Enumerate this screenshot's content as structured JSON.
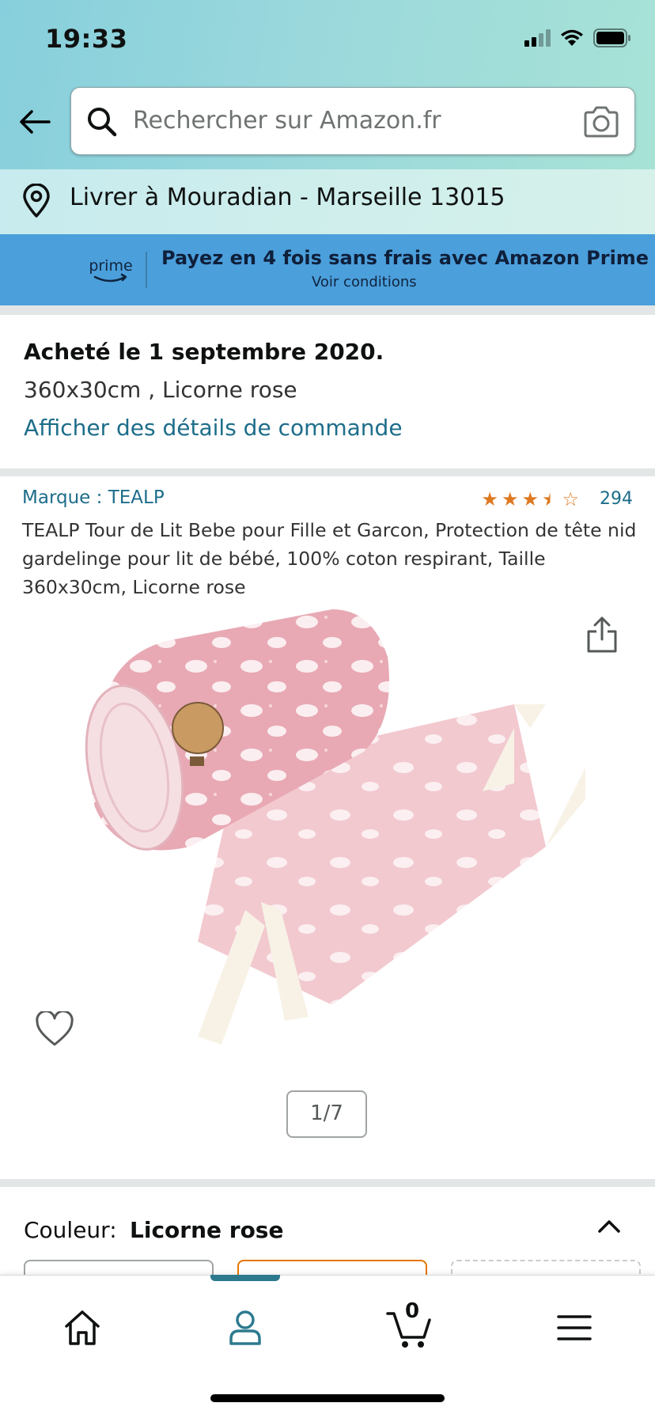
{
  "status": {
    "time": "19:33"
  },
  "search": {
    "placeholder": "Rechercher sur Amazon.fr"
  },
  "delivery": {
    "text": "Livrer à Mouradian - Marseille 13015"
  },
  "prime_banner": {
    "logo_text": "prime",
    "title": "Payez en 4 fois sans frais avec Amazon Prime",
    "subtitle": "Voir conditions"
  },
  "order": {
    "bought": "Acheté le 1 septembre 2020.",
    "variant": "360x30cm , Licorne rose",
    "details_link": "Afficher des détails de commande"
  },
  "product": {
    "brand": "Marque : TEALP",
    "rating_stars": 3.5,
    "rating_count": "294",
    "title": "TEALP Tour de Lit Bebe pour Fille et Garcon, Protection de tête nid gardelinge pour lit de bébé, 100% coton respirant, Taille 360x30cm, Licorne rose",
    "image_pager": "1/7"
  },
  "color": {
    "label": "Couleur:",
    "value": "Licorne rose"
  },
  "tabbar": {
    "cart_count": "0",
    "active_tab": "account"
  },
  "colors": {
    "link": "#1d6d8a",
    "star": "#de7921",
    "prime_bg": "#4b9fdb",
    "accent": "#2d7a8f"
  }
}
